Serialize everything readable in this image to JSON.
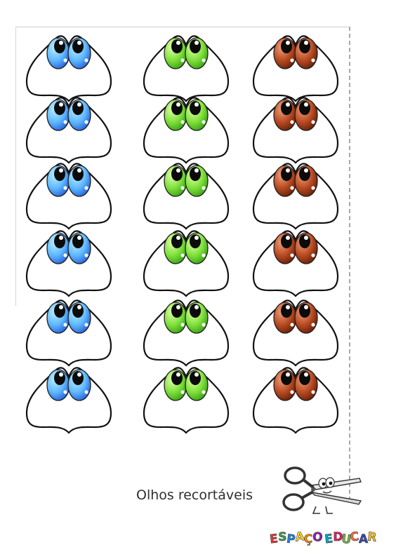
{
  "caption": "Olhos recortáveis",
  "logo_text": "ESPAÇO EDUCAR",
  "logo_colors": [
    "#e53935",
    "#43a047",
    "#1e88e5",
    "#fdd835",
    "#fb8c00",
    "#8e24aa",
    "#00acc1",
    "#e91e63",
    "#7cb342",
    "#ff7043",
    "#3949ab",
    "#fbc02d",
    "#d81b60"
  ],
  "grid": {
    "rows": 6,
    "columns": 3
  },
  "eye_colors": [
    {
      "name": "blue",
      "light": "#bdf0ff",
      "mid": "#5fb8ff",
      "dark": "#1e56d6"
    },
    {
      "name": "green",
      "light": "#e6ffb0",
      "mid": "#7fe03a",
      "dark": "#2f9a10"
    },
    {
      "name": "brown",
      "light": "#f1a27c",
      "mid": "#b84a22",
      "dark": "#5c1a05"
    }
  ],
  "icons": {
    "scissors": "scissors-icon"
  }
}
